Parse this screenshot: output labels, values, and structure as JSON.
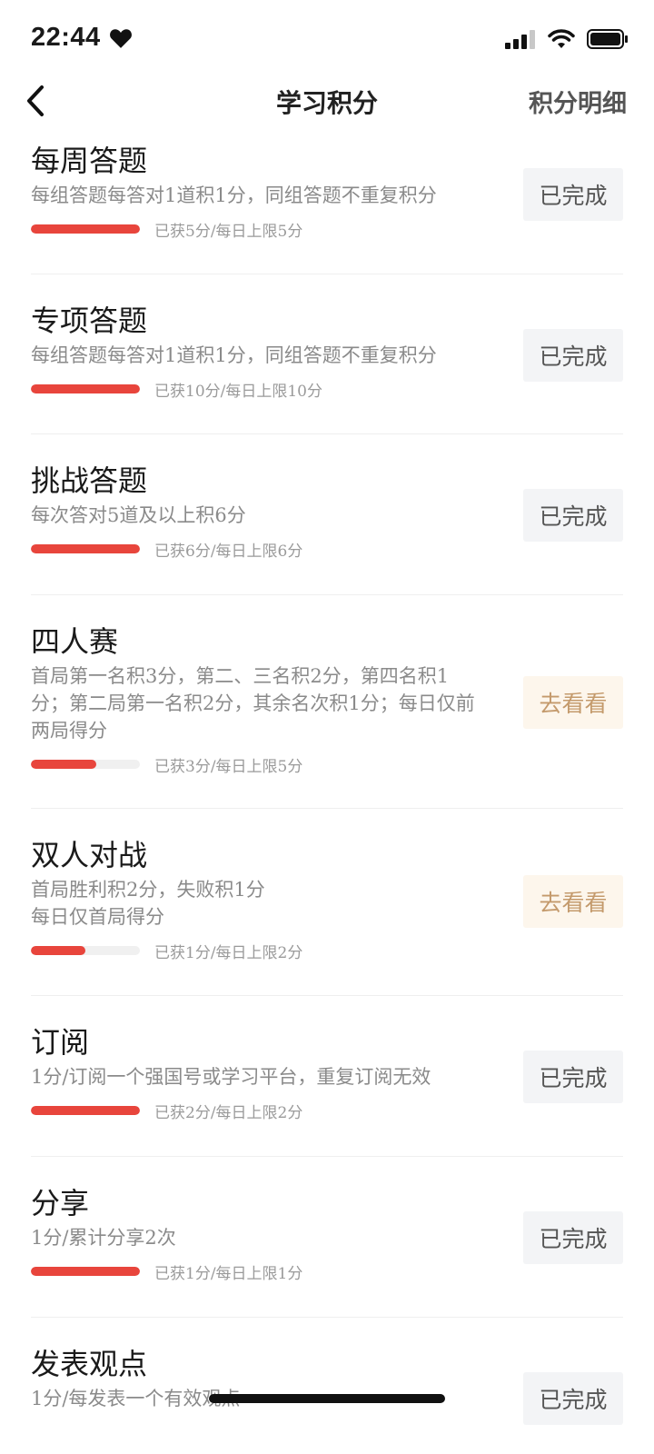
{
  "status_bar": {
    "time": "22:44"
  },
  "nav": {
    "title": "学习积分",
    "right_label": "积分明细"
  },
  "tasks": [
    {
      "title": "每周答题",
      "desc": "每组答题每答对1道积1分，同组答题不重复积分",
      "progress_text": "已获5分/每日上限5分",
      "progress": 1.0,
      "button": "已完成",
      "state": "done"
    },
    {
      "title": "专项答题",
      "desc": "每组答题每答对1道积1分，同组答题不重复积分",
      "progress_text": "已获10分/每日上限10分",
      "progress": 1.0,
      "button": "已完成",
      "state": "done"
    },
    {
      "title": "挑战答题",
      "desc": "每次答对5道及以上积6分",
      "progress_text": "已获6分/每日上限6分",
      "progress": 1.0,
      "button": "已完成",
      "state": "done"
    },
    {
      "title": "四人赛",
      "desc": "首局第一名积3分，第二、三名积2分，第四名积1分；第二局第一名积2分，其余名次积1分；每日仅前两局得分",
      "progress_text": "已获3分/每日上限5分",
      "progress": 0.6,
      "button": "去看看",
      "state": "go"
    },
    {
      "title": "双人对战",
      "desc": "首局胜利积2分，失败积1分\n每日仅首局得分",
      "progress_text": "已获1分/每日上限2分",
      "progress": 0.5,
      "button": "去看看",
      "state": "go"
    },
    {
      "title": "订阅",
      "desc": "1分/订阅一个强国号或学习平台，重复订阅无效",
      "progress_text": "已获2分/每日上限2分",
      "progress": 1.0,
      "button": "已完成",
      "state": "done"
    },
    {
      "title": "分享",
      "desc": "1分/累计分享2次",
      "progress_text": "已获1分/每日上限1分",
      "progress": 1.0,
      "button": "已完成",
      "state": "done"
    },
    {
      "title": "发表观点",
      "desc": "1分/每发表一个有效观点",
      "progress_text": "",
      "progress": 1.0,
      "button": "已完成",
      "state": "done"
    }
  ]
}
